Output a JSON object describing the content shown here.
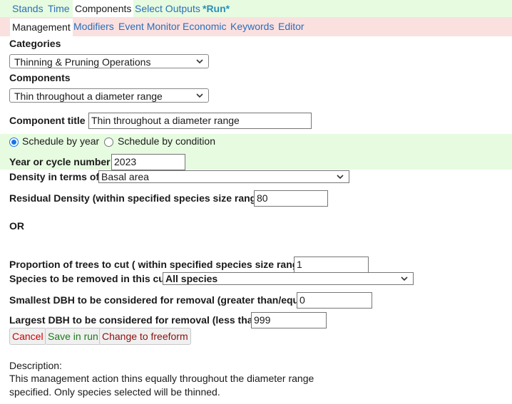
{
  "top_tabs": [
    "Stands",
    "Time",
    "Components",
    "Select Outputs",
    "*Run*"
  ],
  "sub_tabs": [
    "Management",
    "Modifiers",
    "Event Monitor",
    "Economic",
    "Keywords",
    "Editor"
  ],
  "categories": {
    "label": "Categories",
    "selected": "Thinning & Pruning Operations"
  },
  "components": {
    "label": "Components",
    "selected": "Thin throughout a diameter range"
  },
  "component_title": {
    "label": "Component title",
    "value": "Thin throughout a diameter range"
  },
  "schedule": {
    "by_year": "Schedule by year",
    "by_condition": "Schedule by condition",
    "selected": "by_year"
  },
  "year": {
    "label": "Year or cycle number",
    "value": "2023"
  },
  "density": {
    "label": "Density in terms of",
    "selected": "Basal area"
  },
  "residual": {
    "label": "Residual Density (within specified species size range)",
    "value": "80"
  },
  "or_label": "OR",
  "proportion": {
    "label": "Proportion of trees to cut ( within specified species size range)",
    "value": "1"
  },
  "species": {
    "label": "Species to be removed in this cut",
    "selected": "All species"
  },
  "smallest_dbh": {
    "label": "Smallest DBH to be considered for removal (greater than/equal)",
    "value": "0"
  },
  "largest_dbh": {
    "label": "Largest DBH to be considered for removal (less than)",
    "value": "999"
  },
  "buttons": {
    "cancel": "Cancel",
    "save": "Save in run",
    "freeform": "Change to freeform"
  },
  "description": {
    "heading": "Description:",
    "line1": "This management action thins equally throughout the diameter range",
    "line2": "specified. Only species selected will be thinned."
  },
  "colors": {
    "tab_link": "#2a6fb8",
    "top_bar_bg": "#e6fbe0",
    "sub_bar_bg": "#fbe0e0",
    "cancel_text": "#cc0000",
    "save_text": "#1a7a1a",
    "freeform_text": "#8a1010",
    "radio_accent": "#1a73e8"
  },
  "icons": {
    "dropdown": "chevron-down-icon"
  }
}
